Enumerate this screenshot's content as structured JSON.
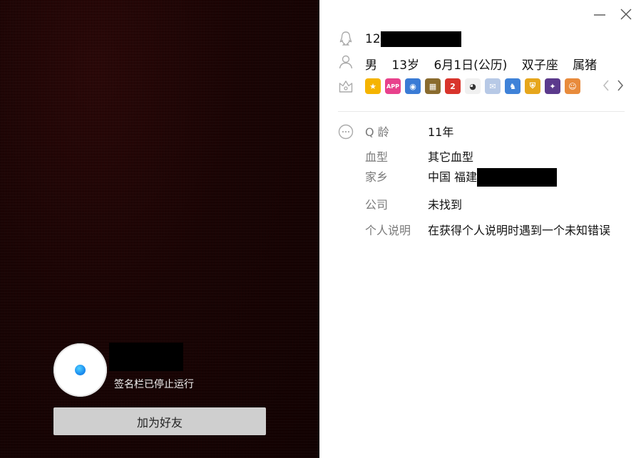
{
  "window": {
    "minimize_label": "minimize",
    "close_label": "close"
  },
  "left_panel": {
    "signature": "签名栏已停止运行",
    "add_friend_button": "加为好友"
  },
  "profile": {
    "qq_number_prefix": "12",
    "gender": "男",
    "age": "13岁",
    "birthday": "6月1日(公历)",
    "zodiac": "双子座",
    "chinese_zodiac": "属猪",
    "badges": [
      {
        "icon": "star-badge-icon",
        "color": "#f5b400",
        "text": "★"
      },
      {
        "icon": "app-badge-icon",
        "color": "#e8418c",
        "text": "APP"
      },
      {
        "icon": "camera-badge-icon",
        "color": "#3a7bd5",
        "text": "◉"
      },
      {
        "icon": "treasure-chest-badge-icon",
        "color": "#8a6b2e",
        "text": "▦"
      },
      {
        "icon": "red-gem-badge-icon",
        "color": "#d8342c",
        "text": "2"
      },
      {
        "icon": "cow-badge-icon",
        "color": "#f0f0f0",
        "text": "◕"
      },
      {
        "icon": "mail-badge-icon",
        "color": "#b7c9e6",
        "text": "✉"
      },
      {
        "icon": "game-character-badge-icon",
        "color": "#3f82d8",
        "text": "♞"
      },
      {
        "icon": "shield-badge-icon",
        "color": "#e6a61c",
        "text": "⛨"
      },
      {
        "icon": "magic-wand-badge-icon",
        "color": "#5b3a8c",
        "text": "✦"
      },
      {
        "icon": "monkey-badge-icon",
        "color": "#e88b3c",
        "text": "☺"
      }
    ],
    "details": [
      {
        "label": "Q 龄",
        "value": "11年"
      },
      {
        "label": "血型",
        "value": "其它血型"
      },
      {
        "label": "家乡",
        "value": "中国 福建"
      },
      {
        "label": "公司",
        "value": "未找到"
      },
      {
        "label": "个人说明",
        "value": "在获得个人说明时遇到一个未知错误"
      }
    ]
  }
}
